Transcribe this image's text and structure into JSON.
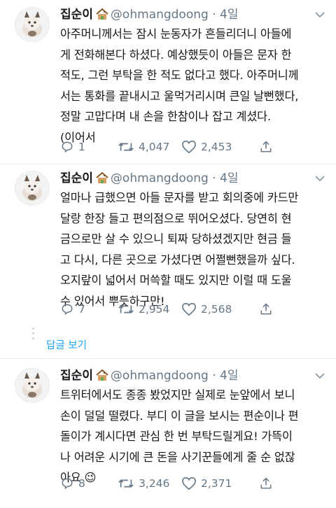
{
  "tweets": [
    {
      "name": "집순이",
      "handle": "@ohmangdoong",
      "time": "4일",
      "text": "아주머니께서는 잠시 눈동자가 흔들리더니 아들에\n게 전화해본다 하셨다. 예상했듯이 아들은 문자 한\n적도, 그런 부탁을 한 적도 없다고 했다. 아주머니께\n서는 통화를 끝내시고 울먹거리시며 큰일 날뻔했다,\n정말 고맙다며 내 손을 한참이나 잡고 계셨다.\n(이어서",
      "replies": "1",
      "retweets": "4,047",
      "likes": "2,453"
    },
    {
      "name": "집순이",
      "handle": "@ohmangdoong",
      "time": "4일",
      "text": "얼마나 급했으면 아들 문자를 받고 회의중에 카드만\n달랑 한장 들고 편의점으로 뛰어오셨다. 당연히 현\n금으로만 살 수 있으니 퇴짜 당하셨겠지만 현금 들\n고 다시, 다른 곳으로 가셨다면 어쩔뻔했을까 싶다.\n오지랖이 넓어서 머쓱할 때도 있지만 이럴 때 도울\n수 있어서 뿌듯하구만!",
      "replies": "7",
      "retweets": "2,954",
      "likes": "2,568"
    },
    {
      "name": "집순이",
      "handle": "@ohmangdoong",
      "time": "4일",
      "text": "트위터에서도 종종 봤었지만 실제로 눈앞에서 보니\n손이 덜덜 떨렸다. 부디 이 글을 보시는 편순이나 편\n돌이가 계시다면 관심 한 번 부탁드릴게요! 가뜩이\n나 어려운 시기에 큰 돈을 사기꾼들에게 줄 순 없잖\n아요 😉",
      "replies": "8",
      "retweets": "3,246",
      "likes": "2,371"
    }
  ],
  "show_replies_label": "답글 보기",
  "colors": {
    "accent": "#1da1f2",
    "muted": "#657786",
    "border": "#e6ecf0",
    "retweet": "#657786"
  }
}
